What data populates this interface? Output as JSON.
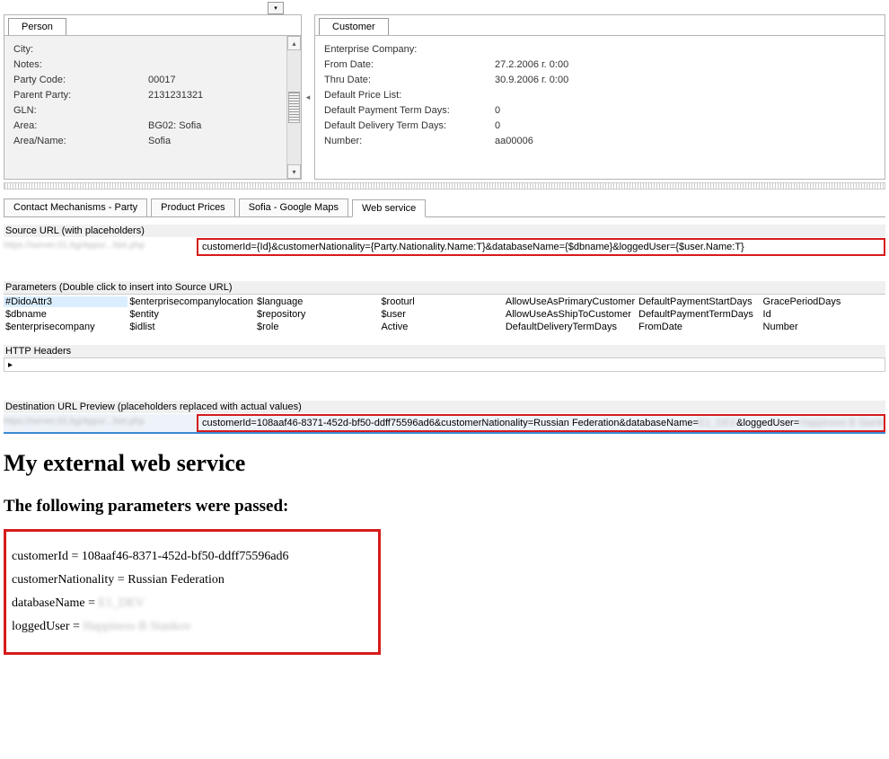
{
  "topDropdown": "▾",
  "personPanel": {
    "tab": "Person",
    "fields": {
      "city_l": "City:",
      "notes_l": "Notes:",
      "partycode_l": "Party Code:",
      "partycode_v": "00017",
      "parentparty_l": "Parent Party:",
      "parentparty_v": "2131231321",
      "gln_l": "GLN:",
      "area_l": "Area:",
      "area_v": "BG02: Sofia",
      "areaname_l": "Area/Name:",
      "areaname_v": "Sofia"
    }
  },
  "customerPanel": {
    "tab": "Customer",
    "fields": {
      "ent_l": "Enterprise Company:",
      "from_l": "From Date:",
      "from_v": "27.2.2006 г. 0:00",
      "thru_l": "Thru Date:",
      "thru_v": "30.9.2006 г. 0:00",
      "price_l": "Default Price List:",
      "pay_l": "Default Payment Term Days:",
      "pay_v": "0",
      "del_l": "Default Delivery Term Days:",
      "del_v": "0",
      "num_l": "Number:",
      "num_v": "aa00006"
    }
  },
  "lowerTabs": {
    "t1": "Contact Mechanisms - Party",
    "t2": "Product Prices",
    "t3": "Sofia - Google Maps",
    "t4": "Web service"
  },
  "sourceUrl": {
    "label": "Source URL (with placeholders)",
    "prefix": "https://server.01.bg/Apps/...Net.php",
    "value": "customerId={Id}&customerNationality={Party.Nationality.Name:T}&databaseName={$dbname}&loggedUser={$user.Name:T}"
  },
  "paramsLabel": "Parameters (Double click to insert into Source URL)",
  "params": {
    "c1": [
      "#DidoAttr3",
      "$dbname",
      "$enterprisecompany"
    ],
    "c2": [
      "$enterprisecompanylocation",
      "$entity",
      "$idlist"
    ],
    "c3": [
      "$language",
      "$repository",
      "$role"
    ],
    "c4": [
      "$rooturl",
      "$user",
      "Active"
    ],
    "c5": [
      "AllowUseAsPrimaryCustomer",
      "AllowUseAsShipToCustomer",
      "DefaultDeliveryTermDays"
    ],
    "c6": [
      "DefaultPaymentStartDays",
      "DefaultPaymentTermDays",
      "FromDate"
    ],
    "c7": [
      "GracePeriodDays",
      "Id",
      "Number"
    ]
  },
  "httpHeaders": {
    "label": "HTTP Headers",
    "arrow": "▸"
  },
  "destUrl": {
    "label": "Destination URL Preview (placeholders replaced with actual values)",
    "prefix": "https://server.01.bg/Apps/...Net.php",
    "value_a": "customerId=108aaf46-8371-452d-bf50-ddff75596ad6&customerNationality=Russian Federation&databaseName=",
    "blur1": "E1_DEV",
    "mid": " &loggedUser=",
    "blur2": "Happiness B Stankov"
  },
  "webpage": {
    "title": "My external web service",
    "subtitle": "The following parameters were passed:",
    "rows": {
      "r1": "customerId = 108aaf46-8371-452d-bf50-ddff75596ad6",
      "r2": "customerNationality = Russian Federation",
      "r3a": "databaseName = ",
      "r3b": "E1_DEV",
      "r4a": "loggedUser = ",
      "r4b": "Happiness B Stankov"
    }
  }
}
